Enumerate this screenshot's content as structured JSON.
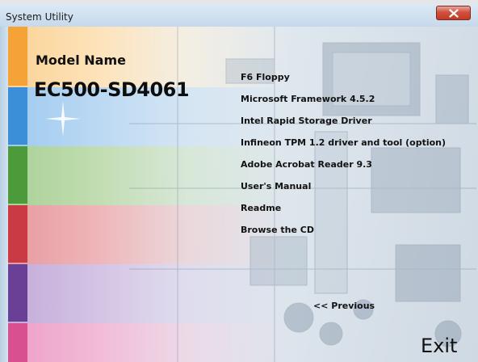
{
  "window": {
    "title": "System Utility"
  },
  "model": {
    "label": "Model Name",
    "value": "EC500-SD4061"
  },
  "menu": {
    "items": [
      "F6 Floppy",
      "Microsoft Framework 4.5.2",
      "Intel Rapid Storage Driver",
      "Infineon TPM 1.2 driver and tool (option)",
      "Adobe Acrobat Reader 9.3",
      "User's Manual",
      "Readme",
      "Browse the CD"
    ]
  },
  "navigation": {
    "previous_label": "<< Previous",
    "exit_label": "Exit"
  },
  "colors": {
    "band_orange": "#f5a236",
    "band_blue": "#3a8fd8",
    "band_green": "#4c9b3a",
    "band_red": "#c93a45",
    "band_purple": "#6a3f96",
    "band_pink": "#d8508f",
    "close_button": "#c9412c"
  }
}
